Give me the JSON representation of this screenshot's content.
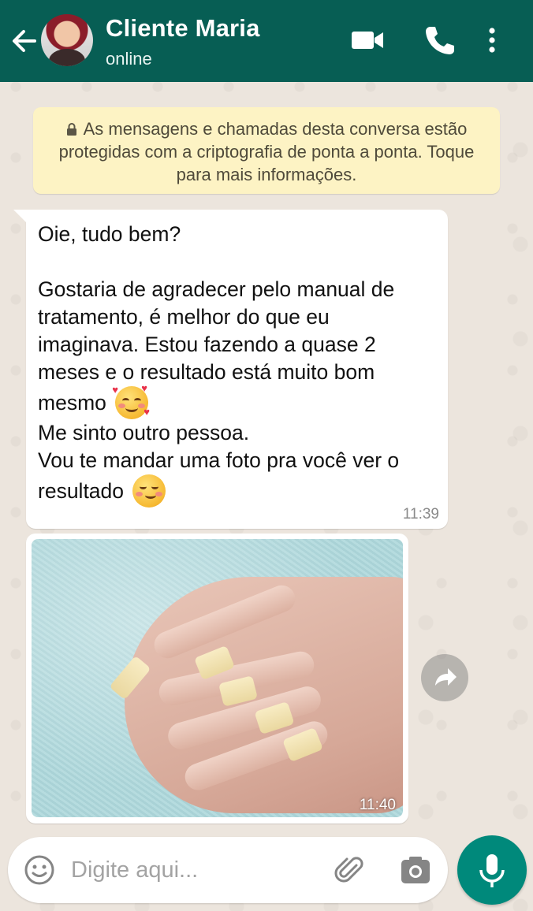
{
  "header": {
    "contact_name": "Cliente Maria",
    "status": "online",
    "icons": [
      "back-arrow-icon",
      "video-call-icon",
      "voice-call-icon",
      "more-options-icon"
    ],
    "color": "#075e54"
  },
  "encryption_notice": {
    "text": "As mensagens e chamadas desta conversa estão protegidas com a criptografia de ponta a ponta. Toque para mais informações.",
    "icon": "lock-icon"
  },
  "messages": [
    {
      "type": "text",
      "direction": "incoming",
      "lines": [
        "Oie, tudo bem?",
        "",
        "Gostaria de agradecer pelo manual de tratamento, é melhor do que eu imaginava. Estou fazendo a quase 2 meses e o resultado está muito bom mesmo",
        "Me sinto outro pessoa.",
        "Vou te mandar uma foto pra você ver o resultado"
      ],
      "emojis": [
        "smiling-face-with-hearts",
        "smirking-face"
      ],
      "time": "11:39"
    },
    {
      "type": "image",
      "direction": "incoming",
      "description_icon": "photo-hand-nails",
      "time": "11:40"
    }
  ],
  "composer": {
    "placeholder": "Digite aqui...",
    "icons": [
      "emoji-icon",
      "attach-icon",
      "camera-icon",
      "mic-icon"
    ],
    "mic_color": "#00897b"
  }
}
